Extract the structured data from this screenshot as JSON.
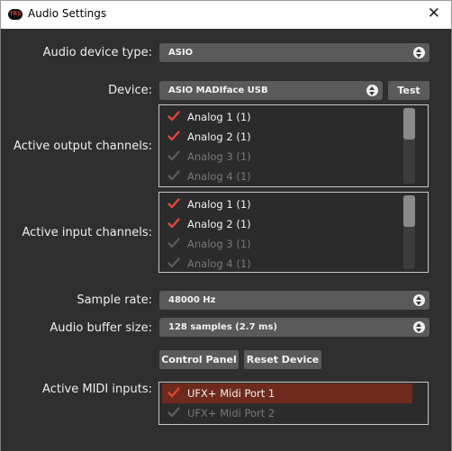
{
  "window": {
    "title": "Audio Settings",
    "app_icon_text": "TRS",
    "close_glyph": "✕"
  },
  "device_type": {
    "label": "Audio device type:",
    "value": "ASIO"
  },
  "device": {
    "label": "Device:",
    "value": "ASIO MADIface USB",
    "test_label": "Test"
  },
  "output_channels": {
    "label": "Active output channels:",
    "items": [
      {
        "label": "Analog 1 (1)",
        "enabled": true
      },
      {
        "label": "Analog 2 (1)",
        "enabled": true
      },
      {
        "label": "Analog 3 (1)",
        "enabled": false
      },
      {
        "label": "Analog 4 (1)",
        "enabled": false
      }
    ]
  },
  "input_channels": {
    "label": "Active input channels:",
    "items": [
      {
        "label": "Analog 1 (1)",
        "enabled": true
      },
      {
        "label": "Analog 2 (1)",
        "enabled": true
      },
      {
        "label": "Analog 3 (1)",
        "enabled": false
      },
      {
        "label": "Analog 4 (1)",
        "enabled": false
      }
    ]
  },
  "sample_rate": {
    "label": "Sample rate:",
    "value": "48000 Hz"
  },
  "buffer_size": {
    "label": "Audio buffer size:",
    "value": "128 samples (2.7 ms)"
  },
  "buttons": {
    "control_panel": "Control Panel",
    "reset_device": "Reset Device"
  },
  "midi_inputs": {
    "label": "Active MIDI inputs:",
    "items": [
      {
        "label": "UFX+ Midi Port 1",
        "enabled": true,
        "selected": true
      },
      {
        "label": "UFX+ Midi Port 2",
        "enabled": false,
        "selected": false
      }
    ]
  },
  "colors": {
    "check_on": "#e0473a",
    "check_off": "#5a5a5a",
    "selected_row": "#6e2a1c",
    "background": "#2f2f2f"
  }
}
